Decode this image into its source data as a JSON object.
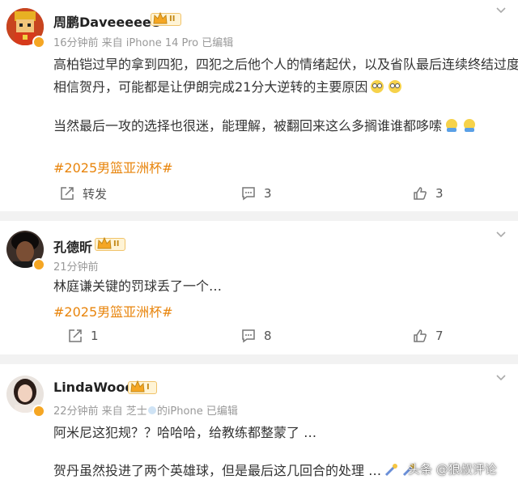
{
  "posts": [
    {
      "name": "周鹏Daveeeeee",
      "level": "II",
      "meta": "16分钟前  来自 iPhone 14 Pro 已编辑",
      "line1": "高柏铠过早的拿到四犯，四犯之后他个人的情绪起伏，以及省队最后连续终结过度",
      "line2": "相信贺丹，可能都是让伊朗完成21分大逆转的主要原因",
      "line3": "当然最后一攻的选择也很迷，能理解，被翻回来这么多搁谁谁都哆嗦",
      "tag": "#2025男篮亚洲杯#",
      "repost": "转发",
      "comments": "3",
      "likes": "3"
    },
    {
      "name": "孔德昕",
      "level": "II",
      "meta": "21分钟前",
      "line1": "林庭谦关键的罚球丢了一个…",
      "tag": "#2025男篮亚洲杯#",
      "repost": "1",
      "comments": "8",
      "likes": "7"
    },
    {
      "name": "LindaWooo",
      "level": "I",
      "meta_a": "22分钟前  来自 芝士",
      "meta_b": "的iPhone 已编辑",
      "line1": "阿米尼这犯规？？哈哈哈，给教练都整蒙了 …",
      "line2": "贺丹虽然投进了两个英雄球，但是最后这几回合的处理 …"
    }
  ],
  "watermark": "头条 @狼叔评论",
  "colors": {
    "accent": "#e8840b",
    "badge": "#f5a623",
    "text": "#333333",
    "meta": "#999999"
  },
  "icons": [
    "more-chevron-icon",
    "repost-icon",
    "comment-icon",
    "like-icon",
    "level-crown-icon",
    "verified-badge-icon"
  ]
}
